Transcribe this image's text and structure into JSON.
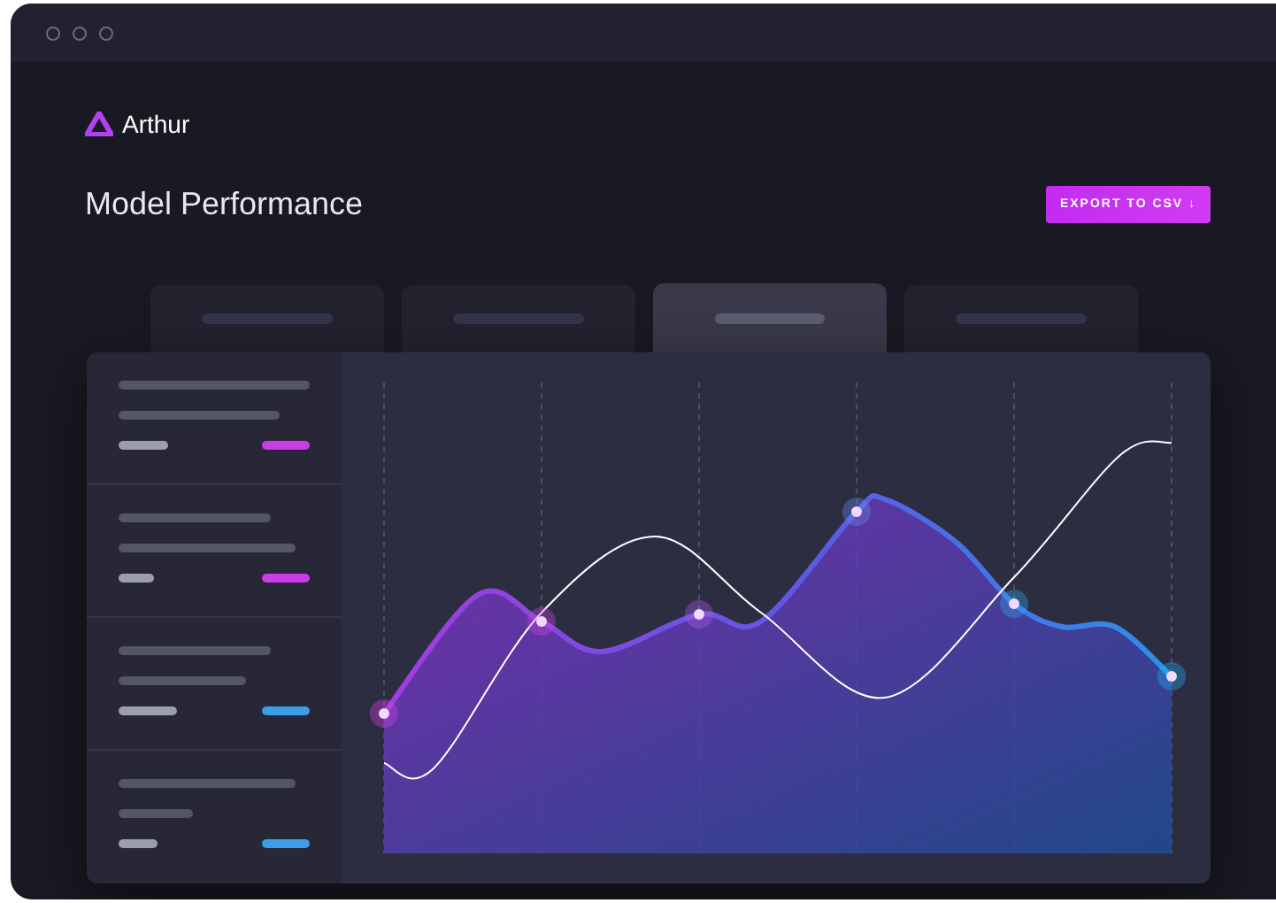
{
  "brand": {
    "name": "Arthur"
  },
  "page_title": "Model Performance",
  "export_button": {
    "label": "EXPORT TO CSV ↓"
  },
  "tabs": [
    {
      "selected": false
    },
    {
      "selected": false
    },
    {
      "selected": true
    },
    {
      "selected": false
    }
  ],
  "list_items": [
    {
      "color": "#c93ce8"
    },
    {
      "color": "#c93ce8"
    },
    {
      "color": "#3a9ee8"
    },
    {
      "color": "#3a9ee8"
    }
  ]
}
